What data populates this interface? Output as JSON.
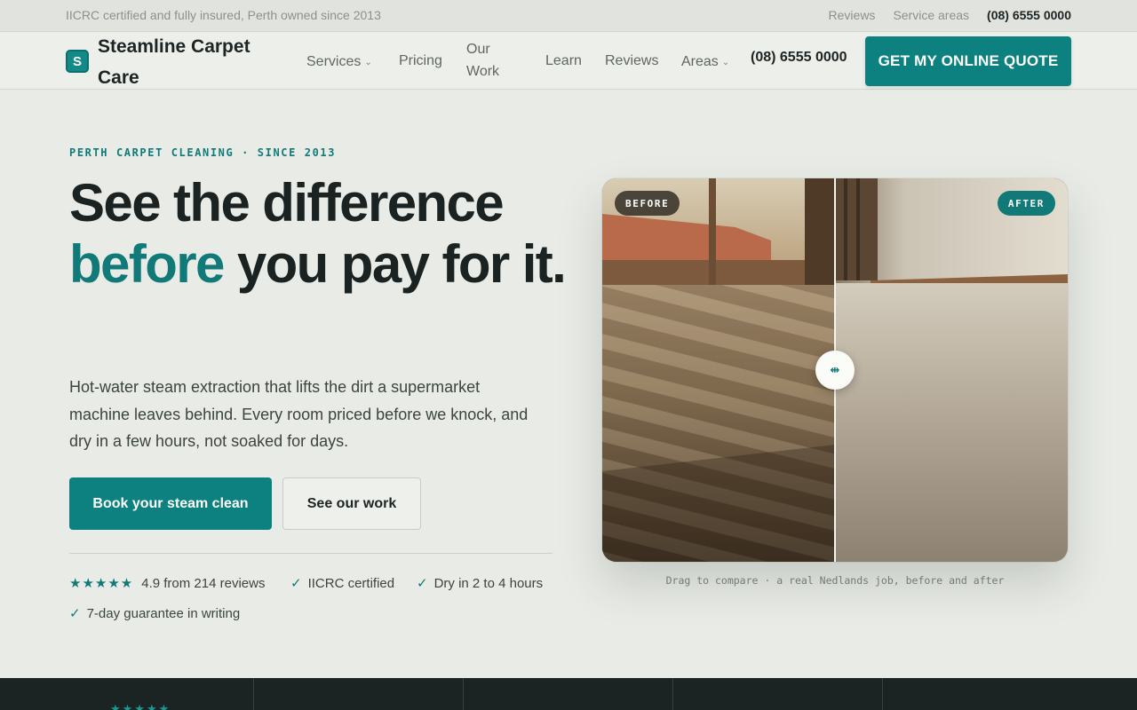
{
  "utility_bar": {
    "tagline": "IICRC certified and fully insured, Perth owned since 2013",
    "links": [
      "Reviews",
      "Service areas"
    ],
    "phone": "(08) 6555 0000"
  },
  "header": {
    "logo_letter": "S",
    "brand": "Steamline Carpet Care",
    "nav": {
      "services": "Services",
      "pricing": "Pricing",
      "our_work": "Our Work",
      "learn": "Learn",
      "reviews": "Reviews",
      "areas": "Areas"
    },
    "phone": "(08) 6555 0000",
    "cta": "GET MY ONLINE QUOTE"
  },
  "hero": {
    "eyebrow": "PERTH CARPET CLEANING · SINCE 2013",
    "headline_line1": "See the difference",
    "headline_accent": "before",
    "headline_rest": " you pay for it.",
    "lede": "Hot-water steam extraction that lifts the dirt a supermarket machine leaves behind. Every room priced before we knock, and dry in a few hours, not soaked for days.",
    "primary_cta": "Book your steam clean",
    "secondary_cta": "See our work",
    "rating_stars": "★★★★★",
    "rating_text": "4.9 from 214 reviews",
    "badges": [
      "IICRC certified",
      "Dry in 2 to 4 hours",
      "7-day guarantee in writing"
    ]
  },
  "compare": {
    "before_label": "BEFORE",
    "after_label": "AFTER",
    "handle_glyph": "⇹",
    "caption": "Drag to compare · a real Nedlands job, before and after"
  },
  "strip": {
    "stars": "★★★★★"
  },
  "colors": {
    "accent": "#0d8080",
    "background": "#e9ece6",
    "dark": "#1b2323"
  }
}
